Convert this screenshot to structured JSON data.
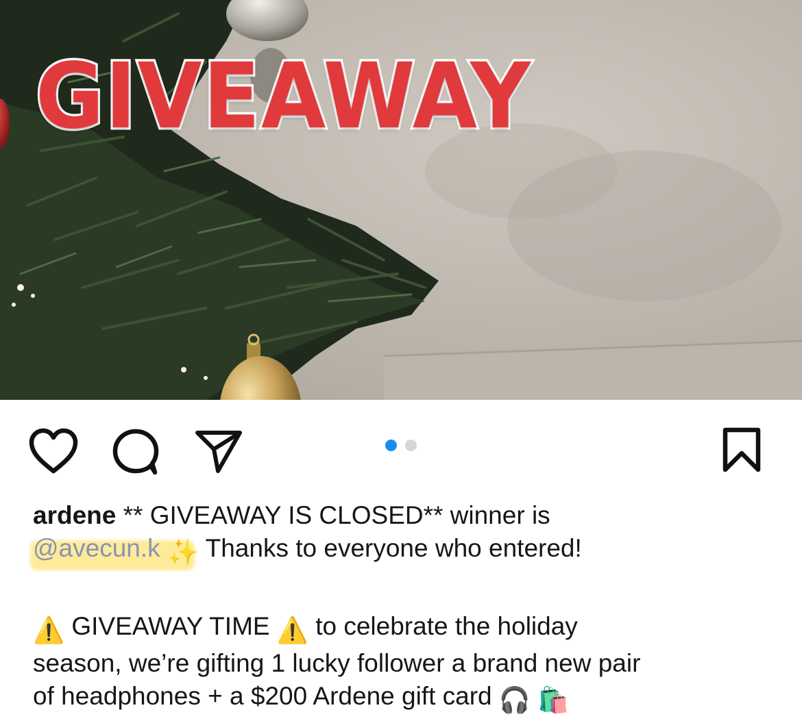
{
  "post": {
    "image": {
      "overlay_text": "GIVEAWAY",
      "overlay_color": "#e03a3c",
      "overlay_outline": "#ffffff",
      "icons": [
        "christmas-tree",
        "ornament"
      ]
    },
    "actions": {
      "like_icon": "heart-icon",
      "comment_icon": "comment-bubble-icon",
      "share_icon": "paper-plane-icon",
      "save_icon": "bookmark-icon"
    },
    "carousel": {
      "current": 1,
      "total": 2,
      "active_color": "#1a8cf0",
      "inactive_color": "#d6d6d6"
    },
    "caption": {
      "username": "ardene",
      "line1_text": " ** GIVEAWAY IS CLOSED** winner is",
      "mention": "@avecun.k",
      "sparkles": "✨",
      "thanks_text": " Thanks to everyone who entered!",
      "warning_emoji": "⚠️",
      "giveaway_time": " GIVEAWAY TIME ",
      "celebrate_text": " to celebrate the holiday",
      "line4": "season, we’re gifting 1 lucky follower a brand new pair",
      "line5_text": "of headphones + a $200 Ardene gift card ",
      "headphones_emoji": "🎧",
      "shopping_emoji": "🛍️"
    }
  }
}
